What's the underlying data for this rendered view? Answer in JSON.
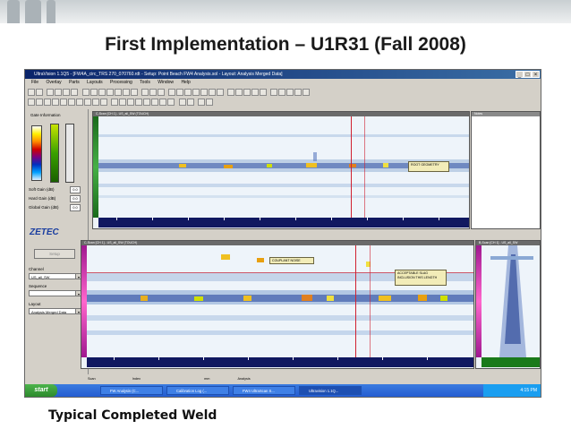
{
  "slide": {
    "title": "First Implementation – U1R31 (Fall 2008)",
    "caption": "Typical Completed Weld"
  },
  "window": {
    "title": "UltraVision 1.1Q5 - [FW4A_circ_TRS 270_070760.rdt - Setup: Point Beach FW4 Analysis.sol - Layout: Analysis Merged Data]",
    "controls": [
      "_",
      "□",
      "×"
    ]
  },
  "menu": [
    "File",
    "Overlay",
    "Parts",
    "Layouts",
    "Processing",
    "Tools",
    "Window",
    "Help"
  ],
  "left_panel": {
    "panel_title": "Gate Information",
    "fields": [
      {
        "label": "Soft Gain (dB)",
        "value": "0.0"
      },
      {
        "label": "Hard Gain (dB)",
        "value": "0.0"
      },
      {
        "label": "Global Gain (dB)",
        "value": "0.0"
      }
    ],
    "logo": "ZETEC",
    "setup_button": "Setup",
    "channel": {
      "label": "Channel",
      "value": "US_all_SW"
    },
    "sequence": {
      "label": "Sequence",
      "value": ""
    },
    "layout": {
      "label": "Layout",
      "value": "Analysis Merged Data"
    }
  },
  "top_scan": {
    "header": "C-Scan [CH 1] - US_all_SW (TOUCH)",
    "callout": "ROOT GEOMETRY",
    "side_title": "Notes"
  },
  "bottom_scan": {
    "header": "C-Scan [CH 1] - US_all_SW (TOUCH)",
    "side_header": "B-Scan [CH 1] - US_all_SW",
    "callout_left": "COUPLANT NOISE",
    "callout_right": "ACCEPTABLE SLAG INCLUSION THIS LENGTH"
  },
  "statusbar": {
    "scan_label": "Scan",
    "index_label": "Index",
    "units_label": "mm",
    "analysis_label": "Analysis"
  },
  "taskbar": {
    "start": "start",
    "tasks": [
      "FW Analysis (C...",
      "Calibration Log (...",
      "FW4 UltraScan S...",
      "Ultravision 1.1Q..."
    ],
    "clock": "4:15 PM"
  },
  "colors": {
    "titlebar": "#0a246a",
    "taskbar": "#245cd0",
    "start": "#2d8a2d",
    "callout": "#f2ecb8",
    "cursor": "#d02030"
  }
}
